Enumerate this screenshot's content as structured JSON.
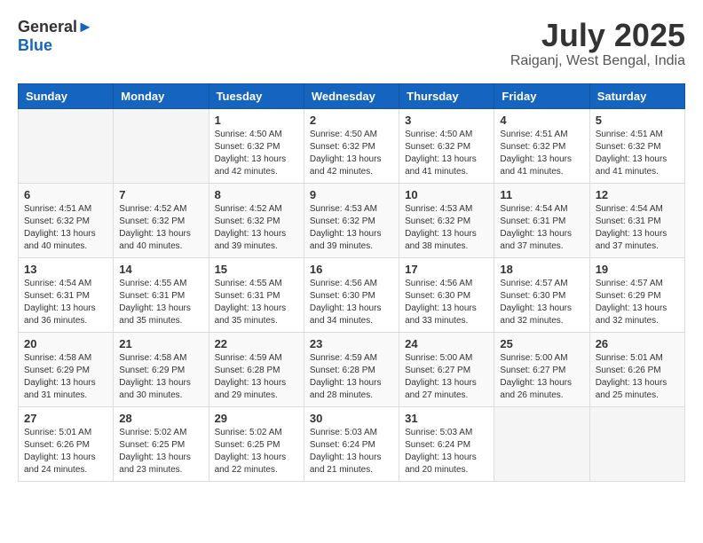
{
  "header": {
    "logo": {
      "general": "General",
      "blue": "Blue"
    },
    "title": "July 2025",
    "location": "Raiganj, West Bengal, India"
  },
  "calendar": {
    "days_of_week": [
      "Sunday",
      "Monday",
      "Tuesday",
      "Wednesday",
      "Thursday",
      "Friday",
      "Saturday"
    ],
    "weeks": [
      [
        {
          "day": "",
          "info": ""
        },
        {
          "day": "",
          "info": ""
        },
        {
          "day": "1",
          "info": "Sunrise: 4:50 AM\nSunset: 6:32 PM\nDaylight: 13 hours and 42 minutes."
        },
        {
          "day": "2",
          "info": "Sunrise: 4:50 AM\nSunset: 6:32 PM\nDaylight: 13 hours and 42 minutes."
        },
        {
          "day": "3",
          "info": "Sunrise: 4:50 AM\nSunset: 6:32 PM\nDaylight: 13 hours and 41 minutes."
        },
        {
          "day": "4",
          "info": "Sunrise: 4:51 AM\nSunset: 6:32 PM\nDaylight: 13 hours and 41 minutes."
        },
        {
          "day": "5",
          "info": "Sunrise: 4:51 AM\nSunset: 6:32 PM\nDaylight: 13 hours and 41 minutes."
        }
      ],
      [
        {
          "day": "6",
          "info": "Sunrise: 4:51 AM\nSunset: 6:32 PM\nDaylight: 13 hours and 40 minutes."
        },
        {
          "day": "7",
          "info": "Sunrise: 4:52 AM\nSunset: 6:32 PM\nDaylight: 13 hours and 40 minutes."
        },
        {
          "day": "8",
          "info": "Sunrise: 4:52 AM\nSunset: 6:32 PM\nDaylight: 13 hours and 39 minutes."
        },
        {
          "day": "9",
          "info": "Sunrise: 4:53 AM\nSunset: 6:32 PM\nDaylight: 13 hours and 39 minutes."
        },
        {
          "day": "10",
          "info": "Sunrise: 4:53 AM\nSunset: 6:32 PM\nDaylight: 13 hours and 38 minutes."
        },
        {
          "day": "11",
          "info": "Sunrise: 4:54 AM\nSunset: 6:31 PM\nDaylight: 13 hours and 37 minutes."
        },
        {
          "day": "12",
          "info": "Sunrise: 4:54 AM\nSunset: 6:31 PM\nDaylight: 13 hours and 37 minutes."
        }
      ],
      [
        {
          "day": "13",
          "info": "Sunrise: 4:54 AM\nSunset: 6:31 PM\nDaylight: 13 hours and 36 minutes."
        },
        {
          "day": "14",
          "info": "Sunrise: 4:55 AM\nSunset: 6:31 PM\nDaylight: 13 hours and 35 minutes."
        },
        {
          "day": "15",
          "info": "Sunrise: 4:55 AM\nSunset: 6:31 PM\nDaylight: 13 hours and 35 minutes."
        },
        {
          "day": "16",
          "info": "Sunrise: 4:56 AM\nSunset: 6:30 PM\nDaylight: 13 hours and 34 minutes."
        },
        {
          "day": "17",
          "info": "Sunrise: 4:56 AM\nSunset: 6:30 PM\nDaylight: 13 hours and 33 minutes."
        },
        {
          "day": "18",
          "info": "Sunrise: 4:57 AM\nSunset: 6:30 PM\nDaylight: 13 hours and 32 minutes."
        },
        {
          "day": "19",
          "info": "Sunrise: 4:57 AM\nSunset: 6:29 PM\nDaylight: 13 hours and 32 minutes."
        }
      ],
      [
        {
          "day": "20",
          "info": "Sunrise: 4:58 AM\nSunset: 6:29 PM\nDaylight: 13 hours and 31 minutes."
        },
        {
          "day": "21",
          "info": "Sunrise: 4:58 AM\nSunset: 6:29 PM\nDaylight: 13 hours and 30 minutes."
        },
        {
          "day": "22",
          "info": "Sunrise: 4:59 AM\nSunset: 6:28 PM\nDaylight: 13 hours and 29 minutes."
        },
        {
          "day": "23",
          "info": "Sunrise: 4:59 AM\nSunset: 6:28 PM\nDaylight: 13 hours and 28 minutes."
        },
        {
          "day": "24",
          "info": "Sunrise: 5:00 AM\nSunset: 6:27 PM\nDaylight: 13 hours and 27 minutes."
        },
        {
          "day": "25",
          "info": "Sunrise: 5:00 AM\nSunset: 6:27 PM\nDaylight: 13 hours and 26 minutes."
        },
        {
          "day": "26",
          "info": "Sunrise: 5:01 AM\nSunset: 6:26 PM\nDaylight: 13 hours and 25 minutes."
        }
      ],
      [
        {
          "day": "27",
          "info": "Sunrise: 5:01 AM\nSunset: 6:26 PM\nDaylight: 13 hours and 24 minutes."
        },
        {
          "day": "28",
          "info": "Sunrise: 5:02 AM\nSunset: 6:25 PM\nDaylight: 13 hours and 23 minutes."
        },
        {
          "day": "29",
          "info": "Sunrise: 5:02 AM\nSunset: 6:25 PM\nDaylight: 13 hours and 22 minutes."
        },
        {
          "day": "30",
          "info": "Sunrise: 5:03 AM\nSunset: 6:24 PM\nDaylight: 13 hours and 21 minutes."
        },
        {
          "day": "31",
          "info": "Sunrise: 5:03 AM\nSunset: 6:24 PM\nDaylight: 13 hours and 20 minutes."
        },
        {
          "day": "",
          "info": ""
        },
        {
          "day": "",
          "info": ""
        }
      ]
    ]
  }
}
